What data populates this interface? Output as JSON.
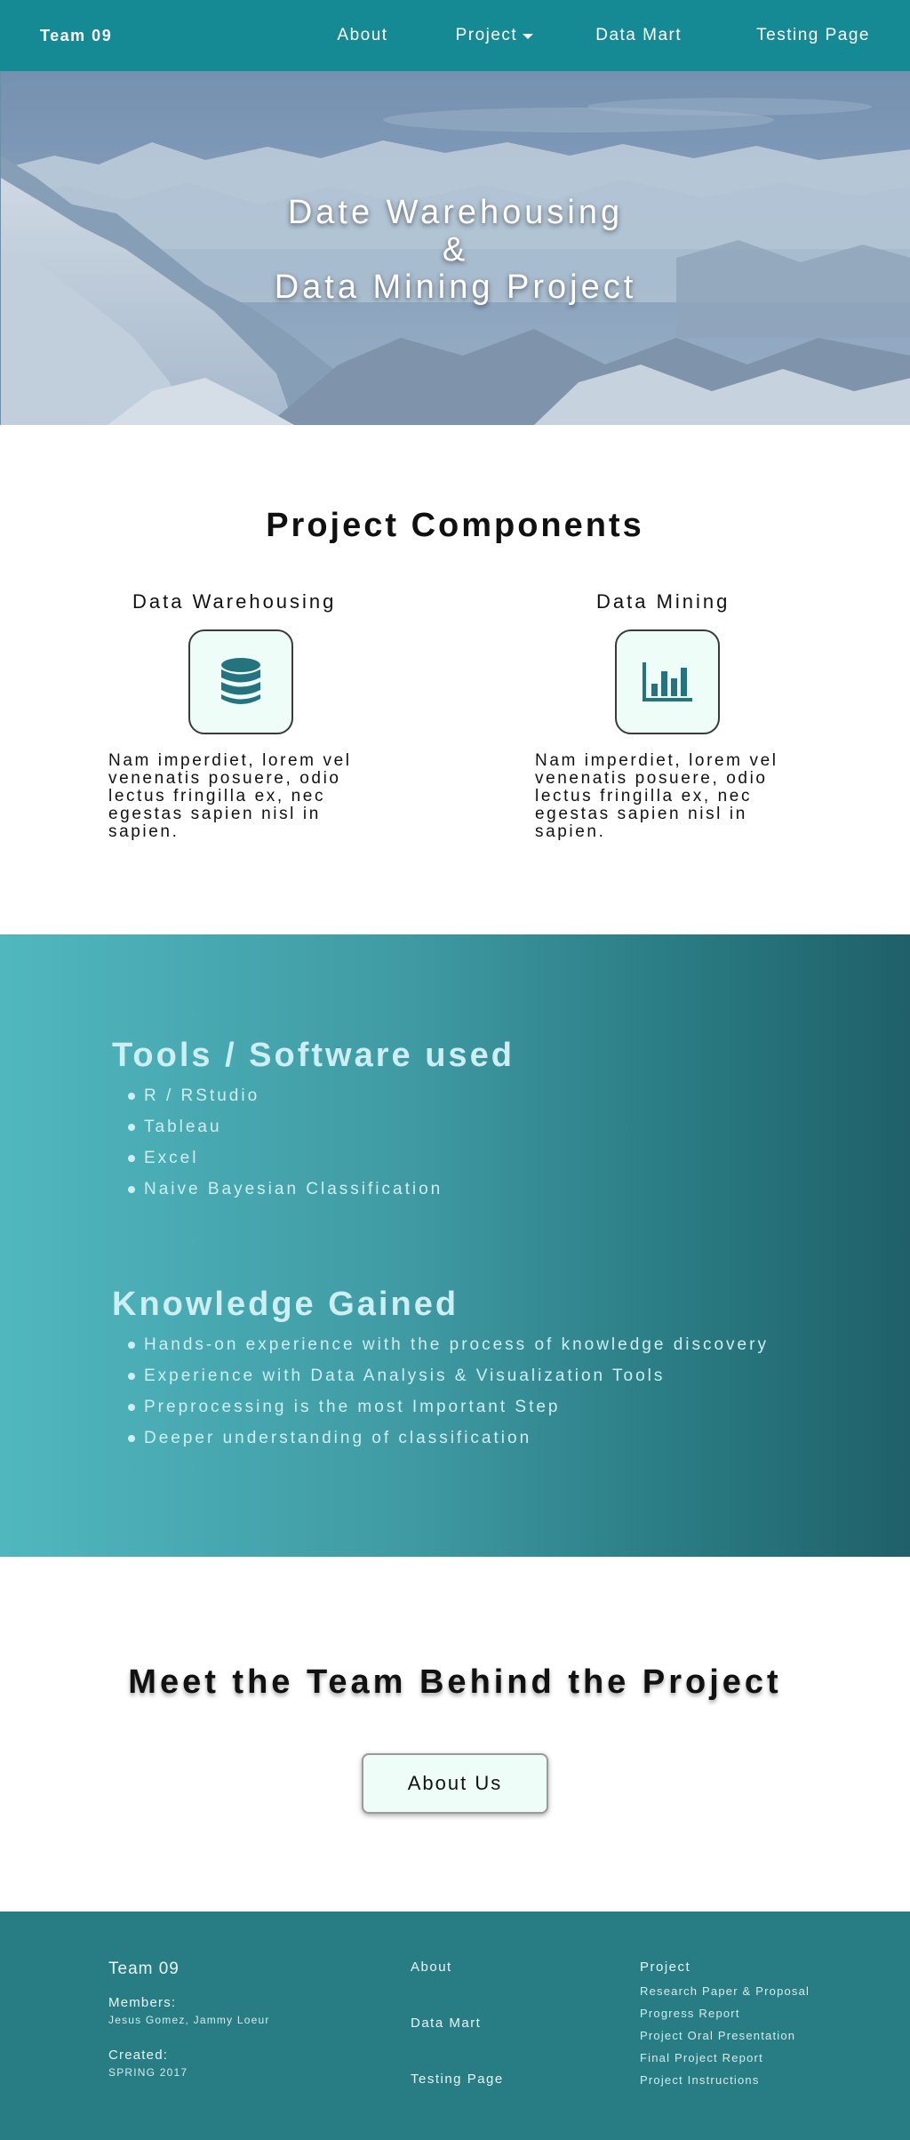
{
  "nav": {
    "brand": "Team 09",
    "links": {
      "about": "About",
      "project": "Project",
      "data_mart": "Data Mart",
      "testing": "Testing Page"
    }
  },
  "hero": {
    "line1": "Date Warehousing",
    "line2": "&",
    "line3": "Data Mining Project"
  },
  "components": {
    "heading": "Project Components",
    "items": [
      {
        "title": "Data Warehousing",
        "icon": "database-icon",
        "text": "Nam imperdiet, lorem vel venenatis posuere, odio lectus fringilla ex, nec egestas sapien nisl in sapien."
      },
      {
        "title": "Data Mining",
        "icon": "bar-chart-icon",
        "text": "Nam imperdiet, lorem vel venenatis posuere, odio lectus fringilla ex, nec egestas sapien nisl in sapien."
      }
    ]
  },
  "tools": {
    "heading": "Tools / Software used",
    "items": [
      "R / RStudio",
      "Tableau",
      "Excel",
      "Naive Bayesian Classification"
    ]
  },
  "knowledge": {
    "heading": "Knowledge Gained",
    "items": [
      "Hands-on experience with the process of knowledge discovery",
      "Experience with Data Analysis & Visualization Tools",
      "Preprocessing is the most Important Step",
      "Deeper understanding of classification"
    ]
  },
  "team": {
    "heading": "Meet the Team Behind the Project",
    "button": "About Us"
  },
  "footer": {
    "title": "Team 09",
    "members_label": "Members:",
    "members": "Jesus Gomez, Jammy Loeur",
    "created_label": "Created:",
    "created": "SPRING 2017",
    "links": [
      "About",
      "Data Mart",
      "Testing Page"
    ],
    "project_title": "Project",
    "project_links": [
      "Research Paper & Proposal",
      "Progress Report",
      "Project Oral Presentation",
      "Final Project Report",
      "Project Instructions"
    ]
  },
  "colors": {
    "nav": "#168a94",
    "footer": "#287d85",
    "icon_teal": "#25737f",
    "icon_box": "#effdf9"
  }
}
